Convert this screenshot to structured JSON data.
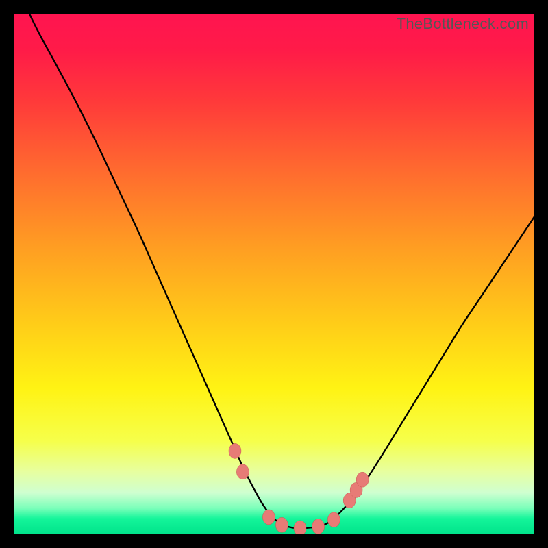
{
  "watermark": "TheBottleneck.com",
  "colors": {
    "background": "#000000",
    "curve_stroke": "#000000",
    "marker_fill": "#e77b76",
    "marker_stroke": "#c85550",
    "gradient_top": "#ff1450",
    "gradient_bottom": "#00e38a"
  },
  "chart_data": {
    "type": "line",
    "title": "",
    "xlabel": "",
    "ylabel": "",
    "xlim": [
      0,
      100
    ],
    "ylim": [
      0,
      100
    ],
    "grid": false,
    "legend": false,
    "series": [
      {
        "name": "curve",
        "x": [
          3,
          5,
          8,
          12,
          16,
          20,
          24,
          28,
          32,
          36,
          38,
          40,
          42,
          44,
          46,
          48,
          50,
          52,
          54,
          56,
          58,
          60,
          62,
          66,
          70,
          74,
          78,
          82,
          86,
          90,
          94,
          98,
          100
        ],
        "y": [
          100,
          96,
          90.5,
          83,
          75,
          66.5,
          58,
          49,
          40,
          31,
          26.5,
          22,
          17.5,
          13,
          9,
          5.5,
          3,
          1.7,
          1.2,
          1.2,
          1.4,
          2,
          3.5,
          8,
          14,
          20.5,
          27,
          33.5,
          40,
          46,
          52,
          58,
          61
        ]
      }
    ],
    "markers": [
      {
        "x": 42.5,
        "y": 16
      },
      {
        "x": 44.0,
        "y": 12
      },
      {
        "x": 49.0,
        "y": 3.3
      },
      {
        "x": 51.5,
        "y": 1.8
      },
      {
        "x": 55.0,
        "y": 1.2
      },
      {
        "x": 58.5,
        "y": 1.5
      },
      {
        "x": 61.5,
        "y": 2.8
      },
      {
        "x": 64.5,
        "y": 6.5
      },
      {
        "x": 65.8,
        "y": 8.5
      },
      {
        "x": 67.0,
        "y": 10.5
      }
    ]
  }
}
